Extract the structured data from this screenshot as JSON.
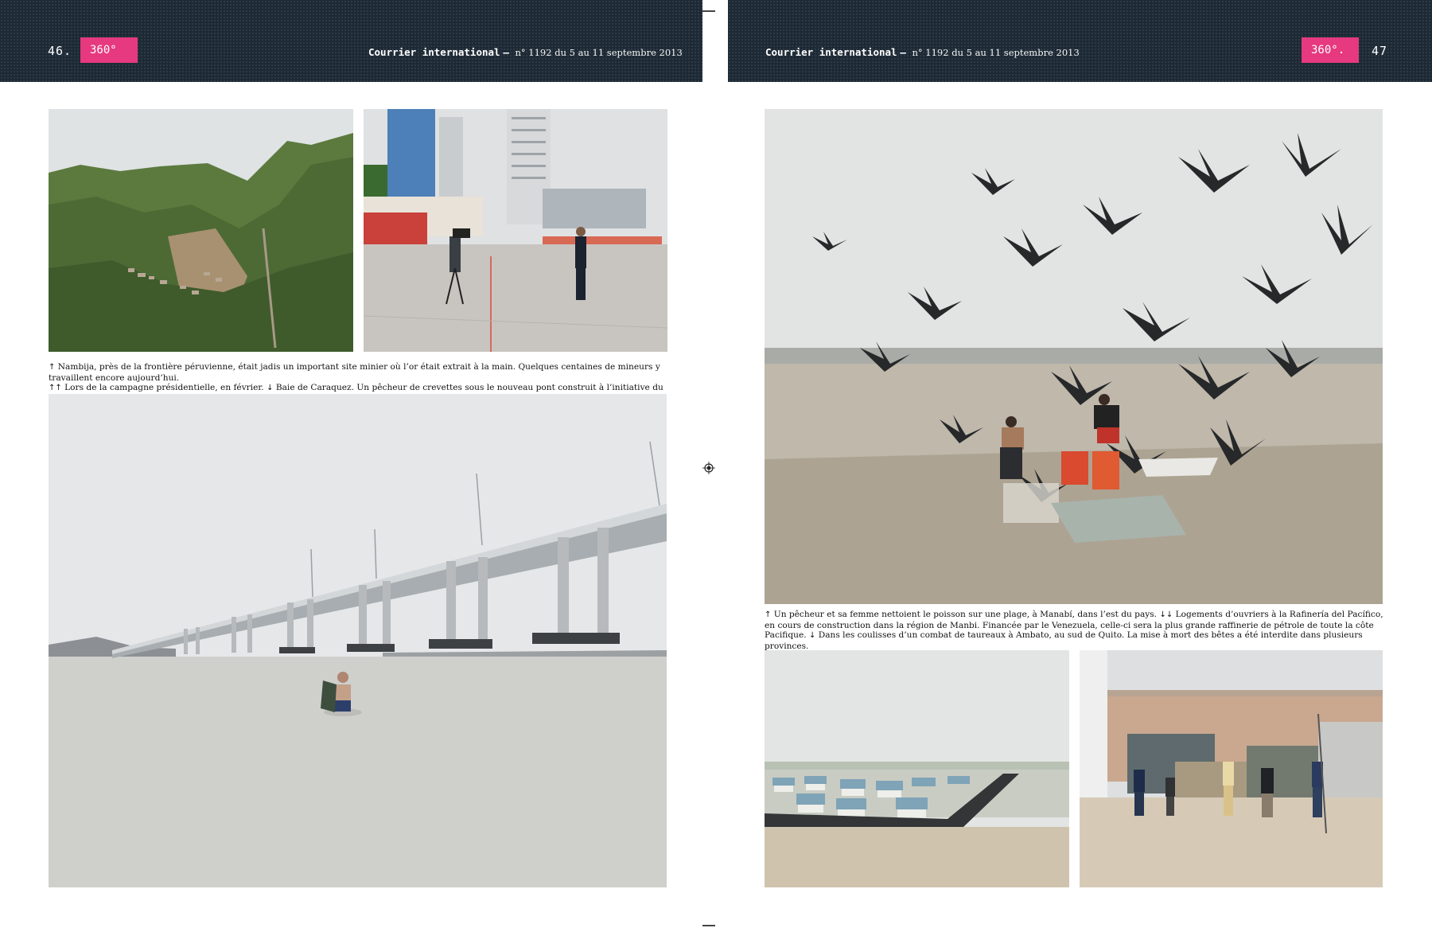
{
  "left_page": {
    "page_number": "46.",
    "section_tag": "360°",
    "masthead_title": "Courrier international",
    "masthead_issue": "n° 1192 du 5 au 11 septembre 2013"
  },
  "right_page": {
    "page_number": "47",
    "section_tag": "360°.",
    "masthead_title": "Courrier international",
    "masthead_issue": "n° 1192 du 5 au 11 septembre 2013"
  },
  "captions": {
    "left": {
      "line1_arrow": "↑",
      "line1": "Nambija, près de la frontière péruvienne, était jadis un important site minier où l’or était extrait à la main. Quelques centaines de mineurs y travaillent encore aujourd’hui.",
      "line2_arrow": "↑↑",
      "line2": "Lors de la campagne présidentielle, en février.",
      "line2b_arrow": "↓",
      "line2b": "Baie de Caraquez. Un pêcheur de crevettes sous le nouveau pont construit à l’initiative du gouvernement."
    },
    "right": {
      "part1_arrow": "↑",
      "part1": "Un pêcheur et sa femme nettoient le poisson sur une plage, à Manabí, dans l’est du pays.",
      "part2_arrow": "↓↓",
      "part2": "Logements d’ouvriers à la Rafinería del Pacífico, en cours de construction dans la région de Manbi. Financée par le Venezuela, celle-ci sera la plus grande raffinerie de pétrole de toute la côte Pacifique.",
      "part3_arrow": "↓",
      "part3": "Dans les coulisses d’un combat de taureaux à Ambato, au sud de Quito. La mise à mort des bêtes a été interdite dans plusieurs provinces."
    }
  },
  "colors": {
    "header_band": "#1d2a35",
    "section_tag": "#e6397f"
  }
}
